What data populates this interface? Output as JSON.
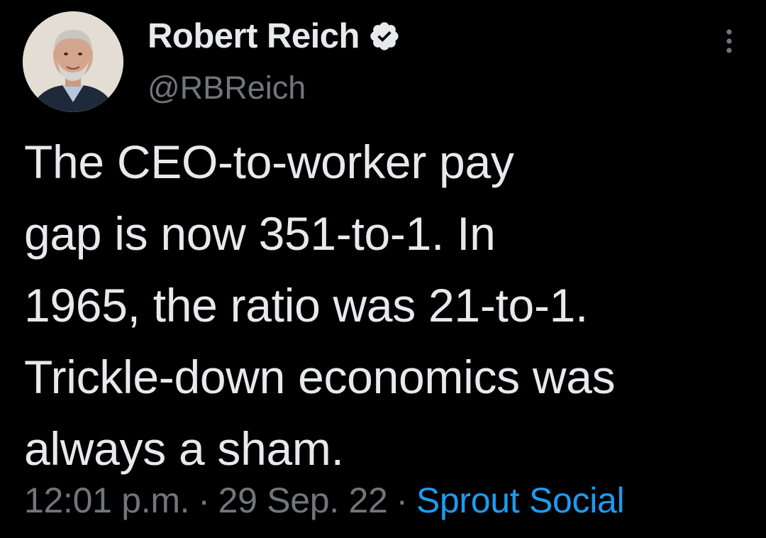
{
  "author": {
    "display_name": "Robert Reich",
    "handle": "@RBReich",
    "verified": true
  },
  "tweet": {
    "text": "The CEO-to-worker pay\ngap is now 351-to-1. In\n1965, the ratio was 21-to-1.\nTrickle-down economics was\nalways a sham."
  },
  "meta": {
    "time": "12:01 p.m.",
    "separator": "·",
    "date": "29 Sep. 22",
    "source": "Sprout Social"
  },
  "icons": {
    "verified": "verified-badge-icon",
    "more": "more-options-icon"
  },
  "colors": {
    "background": "#000000",
    "primary_text": "#e7e9ea",
    "secondary_text": "#71767b",
    "link": "#1d9bf0"
  }
}
